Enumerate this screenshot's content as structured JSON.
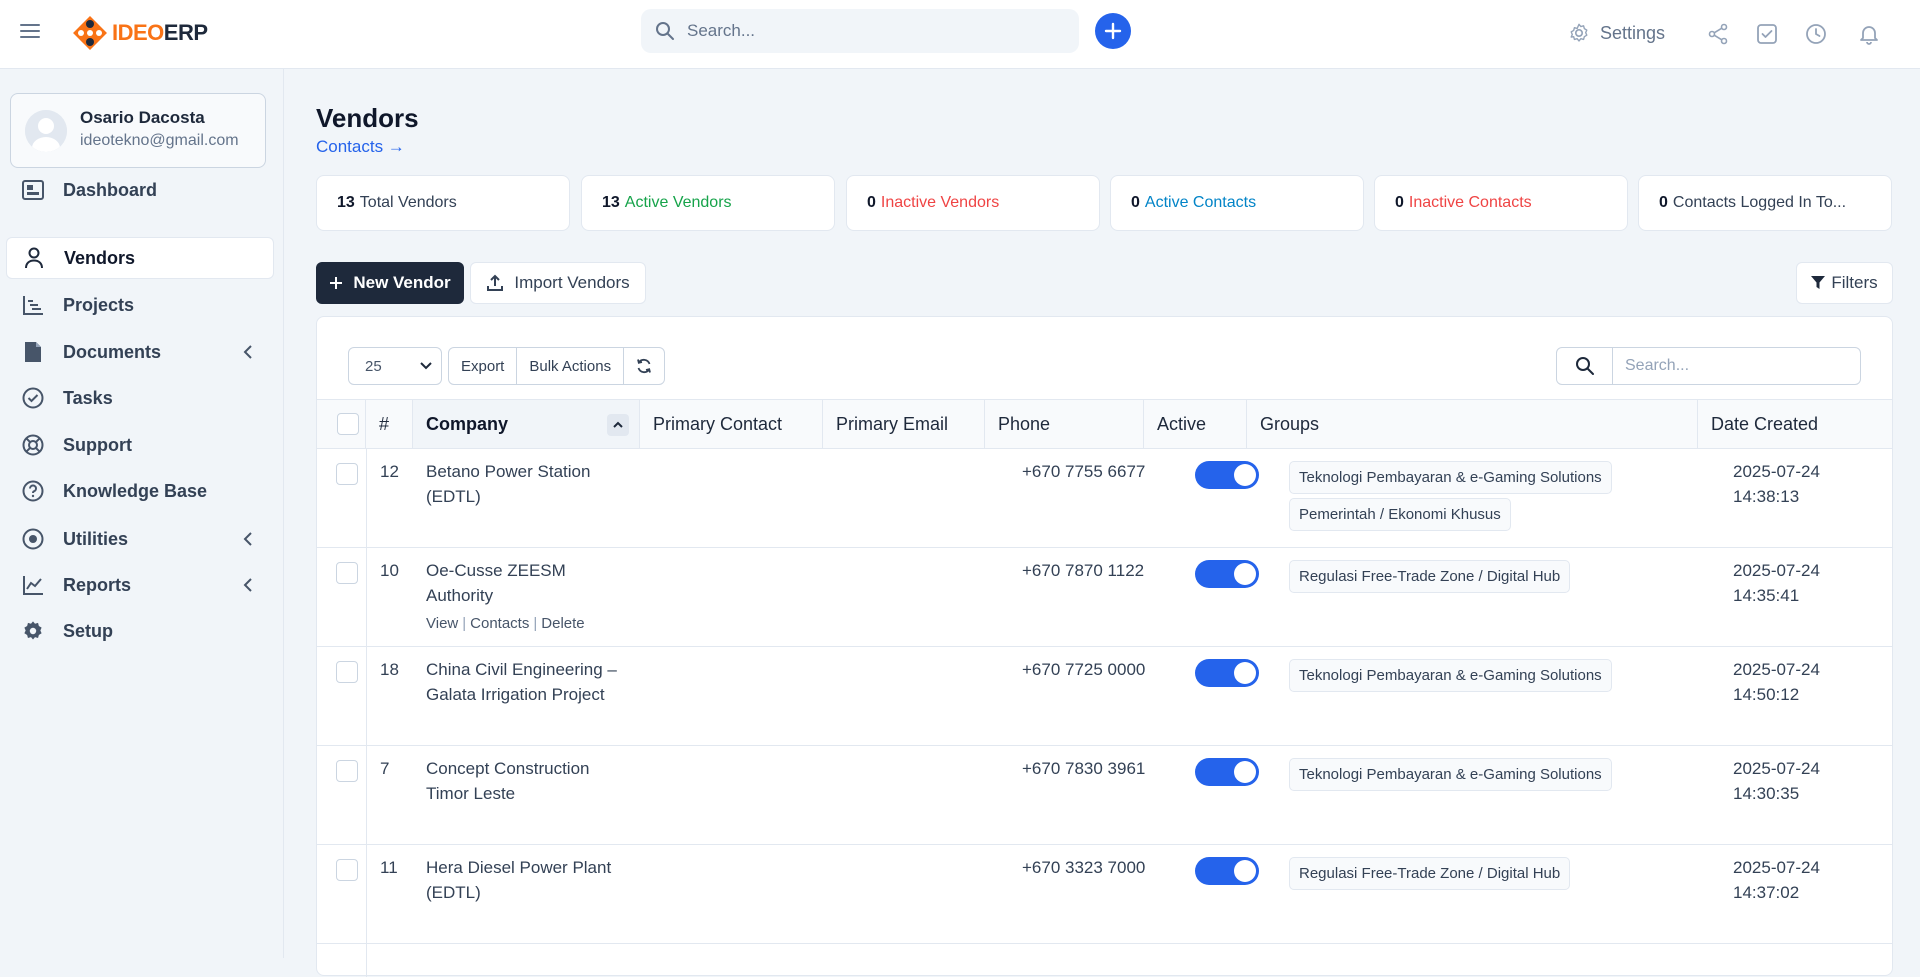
{
  "header": {
    "logo_ideo": "IDEO",
    "logo_erp": "ERP",
    "search_placeholder": "Search...",
    "settings_label": "Settings"
  },
  "user": {
    "name": "Osario Dacosta",
    "email": "ideotekno@gmail.com"
  },
  "sidebar": {
    "items": [
      {
        "label": "Dashboard",
        "icon": "dashboard-icon"
      },
      {
        "label": "Vendors",
        "icon": "user-icon",
        "active": true
      },
      {
        "label": "Projects",
        "icon": "projects-chart-icon"
      },
      {
        "label": "Documents",
        "icon": "file-icon",
        "expandable": true
      },
      {
        "label": "Tasks",
        "icon": "check-circle-icon"
      },
      {
        "label": "Support",
        "icon": "lifebuoy-icon"
      },
      {
        "label": "Knowledge Base",
        "icon": "question-circle-icon"
      },
      {
        "label": "Utilities",
        "icon": "dot-circle-icon",
        "expandable": true
      },
      {
        "label": "Reports",
        "icon": "line-chart-icon",
        "expandable": true
      },
      {
        "label": "Setup",
        "icon": "gear-icon"
      }
    ]
  },
  "page": {
    "title": "Vendors",
    "contacts_link": "Contacts →"
  },
  "stats": [
    {
      "value": "13",
      "label": "Total Vendors",
      "color": "#334155"
    },
    {
      "value": "13",
      "label": "Active Vendors",
      "color": "#16a34a"
    },
    {
      "value": "0",
      "label": "Inactive Vendors",
      "color": "#ef4444"
    },
    {
      "value": "0",
      "label": "Active Contacts",
      "color": "#0284c7"
    },
    {
      "value": "0",
      "label": "Inactive Contacts",
      "color": "#ef4444"
    },
    {
      "value": "0",
      "label": "Contacts Logged In To...",
      "color": "#334155"
    }
  ],
  "actions": {
    "new_vendor": "New Vendor",
    "import_vendors": "Import Vendors",
    "filters": "Filters"
  },
  "table_controls": {
    "per_page": "25",
    "export": "Export",
    "bulk_actions": "Bulk Actions",
    "search_placeholder": "Search..."
  },
  "table": {
    "columns": [
      "#",
      "Company",
      "Primary Contact",
      "Primary Email",
      "Phone",
      "Active",
      "Groups",
      "Date Created"
    ],
    "row_actions": [
      "View",
      "Contacts",
      "Delete"
    ],
    "rows": [
      {
        "id": "12",
        "company": [
          "Betano Power Station",
          "(EDTL)"
        ],
        "phone": "+670 7755 6677",
        "active": true,
        "groups": [
          "Teknologi Pembayaran & e-Gaming Solutions",
          "Pemerintah / Ekonomi Khusus"
        ],
        "date": "2025-07-24",
        "time": "14:38:13"
      },
      {
        "id": "10",
        "company": [
          "Oe-Cusse ZEESM",
          "Authority"
        ],
        "phone": "+670 7870 1122",
        "active": true,
        "groups": [
          "Regulasi Free-Trade Zone / Digital Hub"
        ],
        "date": "2025-07-24",
        "time": "14:35:41",
        "show_actions": true
      },
      {
        "id": "18",
        "company": [
          "China Civil Engineering –",
          "Galata Irrigation Project"
        ],
        "phone": "+670 7725 0000",
        "active": true,
        "groups": [
          "Teknologi Pembayaran & e-Gaming Solutions"
        ],
        "date": "2025-07-24",
        "time": "14:50:12"
      },
      {
        "id": "7",
        "company": [
          "Concept Construction",
          "Timor Leste"
        ],
        "phone": "+670 7830 3961",
        "active": true,
        "groups": [
          "Teknologi Pembayaran & e-Gaming Solutions"
        ],
        "date": "2025-07-24",
        "time": "14:30:35"
      },
      {
        "id": "11",
        "company": [
          "Hera Diesel Power Plant",
          "(EDTL)"
        ],
        "phone": "+670 3323 7000",
        "active": true,
        "groups": [
          "Regulasi Free-Trade Zone / Digital Hub"
        ],
        "date": "2025-07-24",
        "time": "14:37:02"
      }
    ]
  },
  "colors": {
    "accent": "#2563eb",
    "dark_button": "#1e293b",
    "logo_orange": "#f97316"
  }
}
